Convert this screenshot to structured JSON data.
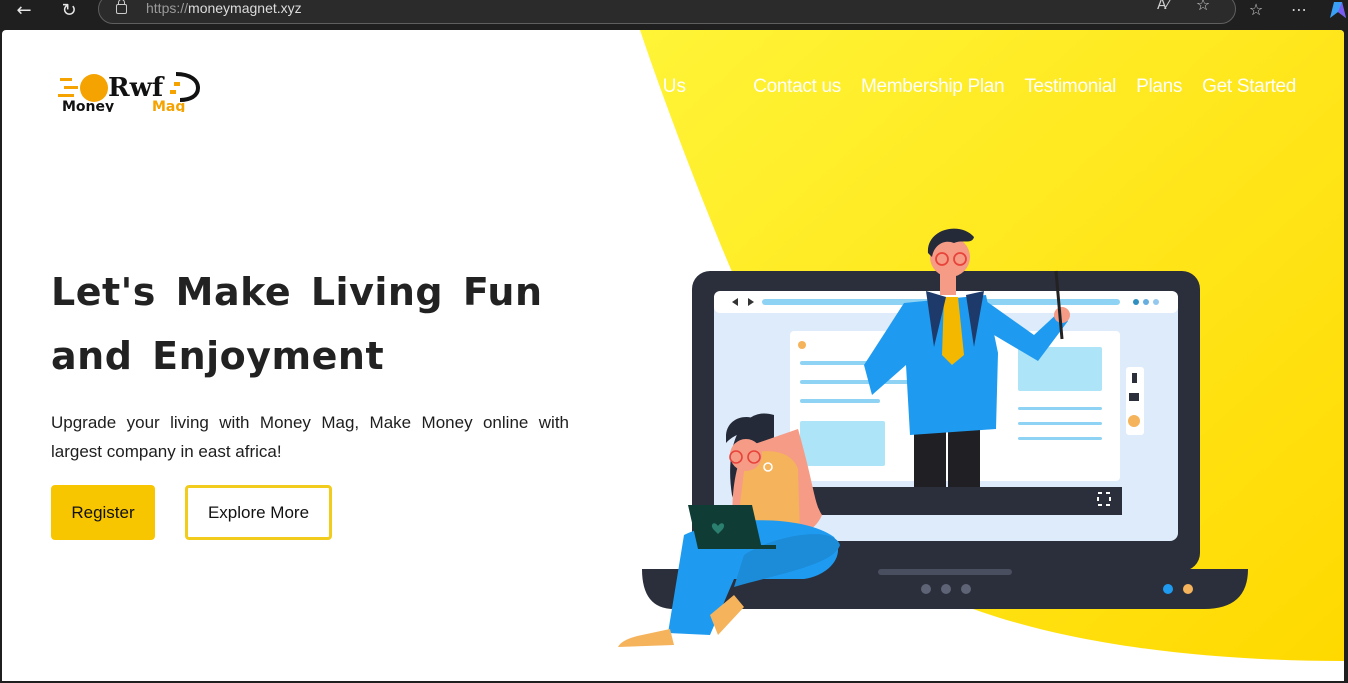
{
  "browser": {
    "url_scheme": "https://",
    "url_host": "moneymagnet.xyz"
  },
  "logo": {
    "wordmark_top": "Rwf",
    "wordmark_bottom_1": "Money",
    "wordmark_bottom_2": "Mag"
  },
  "nav": {
    "partial": "Us",
    "items": [
      "Contact us",
      "Membership Plan",
      "Testimonial",
      "Plans",
      "Get Started"
    ]
  },
  "hero": {
    "title_line1": "Let's Make Living Fun",
    "title_line2": "and Enjoyment",
    "subtitle": "Upgrade your living with Money Mag, Make Money online with largest company in east africa!",
    "register_label": "Register",
    "explore_label": "Explore More"
  },
  "colors": {
    "accent": "#f7c600",
    "yellow_bg": "#ffe51a",
    "dark": "#222222",
    "blue": "#1e9bf0"
  }
}
